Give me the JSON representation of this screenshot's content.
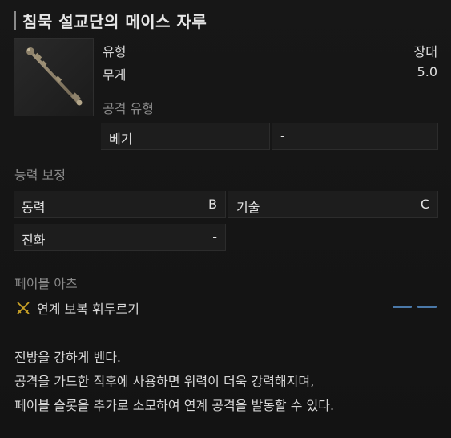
{
  "item": {
    "name": "침묵 설교단의 메이스 자루",
    "icon": "mace-handle-icon"
  },
  "stats": {
    "type_label": "유형",
    "type_value": "장대",
    "weight_label": "무게",
    "weight_value": "5.0"
  },
  "attack_type": {
    "label": "공격 유형",
    "primary": "베기",
    "secondary": "-"
  },
  "scaling": {
    "label": "능력 보정",
    "rows": [
      {
        "name": "동력",
        "grade": "B"
      },
      {
        "name": "기술",
        "grade": "C"
      },
      {
        "name": "진화",
        "grade": "-"
      }
    ]
  },
  "fable_arts": {
    "label": "페이블 아츠",
    "skill_name": "연계 보복 휘두르기",
    "skill_icon": "crossed-swords-icon",
    "cost_color": "#4a78a8"
  },
  "description": {
    "lines": [
      "전방을 강하게 벤다.",
      "공격을 가드한 직후에 사용하면 위력이 더욱 강력해지며,",
      "페이블 슬롯을 추가로 소모하여 연계 공격을 발동할 수 있다."
    ]
  }
}
